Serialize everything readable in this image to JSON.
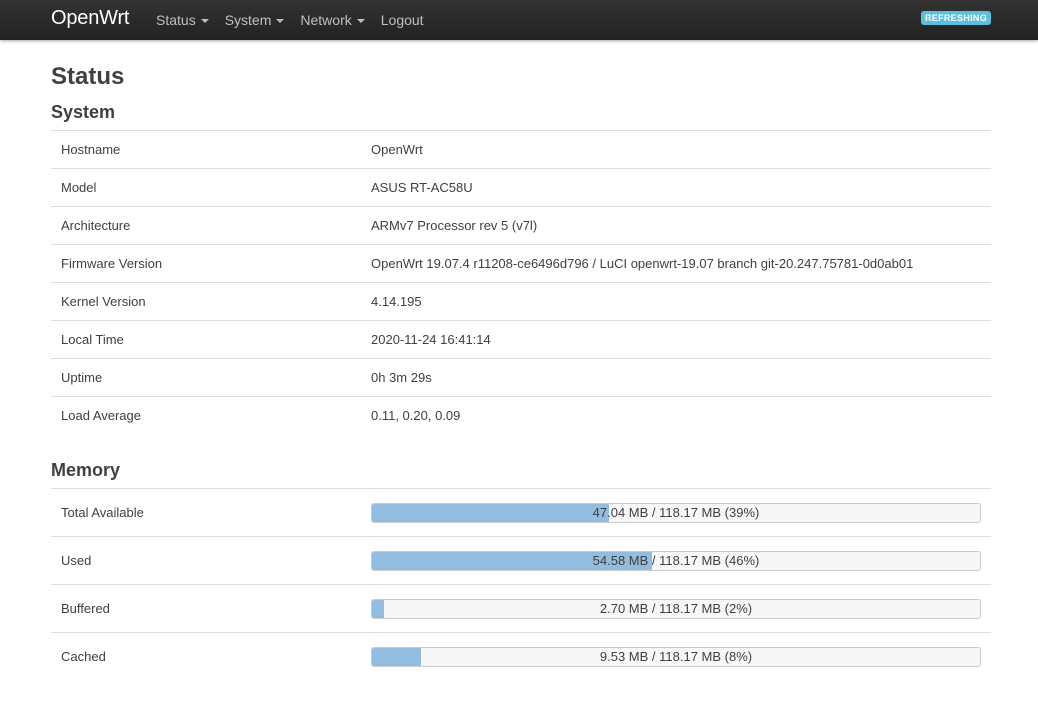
{
  "brand": "OpenWrt",
  "nav": {
    "items": [
      {
        "label": "Status",
        "dropdown": true
      },
      {
        "label": "System",
        "dropdown": true
      },
      {
        "label": "Network",
        "dropdown": true
      },
      {
        "label": "Logout",
        "dropdown": false
      }
    ]
  },
  "badge": {
    "label": "REFRESHING",
    "color": "#5bc0de"
  },
  "page": {
    "title": "Status"
  },
  "system": {
    "heading": "System",
    "rows": [
      {
        "label": "Hostname",
        "value": "OpenWrt"
      },
      {
        "label": "Model",
        "value": "ASUS RT-AC58U"
      },
      {
        "label": "Architecture",
        "value": "ARMv7 Processor rev 5 (v7l)"
      },
      {
        "label": "Firmware Version",
        "value": "OpenWrt 19.07.4 r11208-ce6496d796 / LuCI openwrt-19.07 branch git-20.247.75781-0d0ab01"
      },
      {
        "label": "Kernel Version",
        "value": "4.14.195"
      },
      {
        "label": "Local Time",
        "value": "2020-11-24 16:41:14"
      },
      {
        "label": "Uptime",
        "value": "0h 3m 29s"
      },
      {
        "label": "Load Average",
        "value": "0.11, 0.20, 0.09"
      }
    ]
  },
  "memory": {
    "heading": "Memory",
    "bar_color": "#92bce0",
    "rows": [
      {
        "label": "Total Available",
        "text": "47.04 MB / 118.17 MB (39%)",
        "percent": 39
      },
      {
        "label": "Used",
        "text": "54.58 MB / 118.17 MB (46%)",
        "percent": 46
      },
      {
        "label": "Buffered",
        "text": "2.70 MB / 118.17 MB (2%)",
        "percent": 2
      },
      {
        "label": "Cached",
        "text": "9.53 MB / 118.17 MB (8%)",
        "percent": 8
      }
    ]
  }
}
